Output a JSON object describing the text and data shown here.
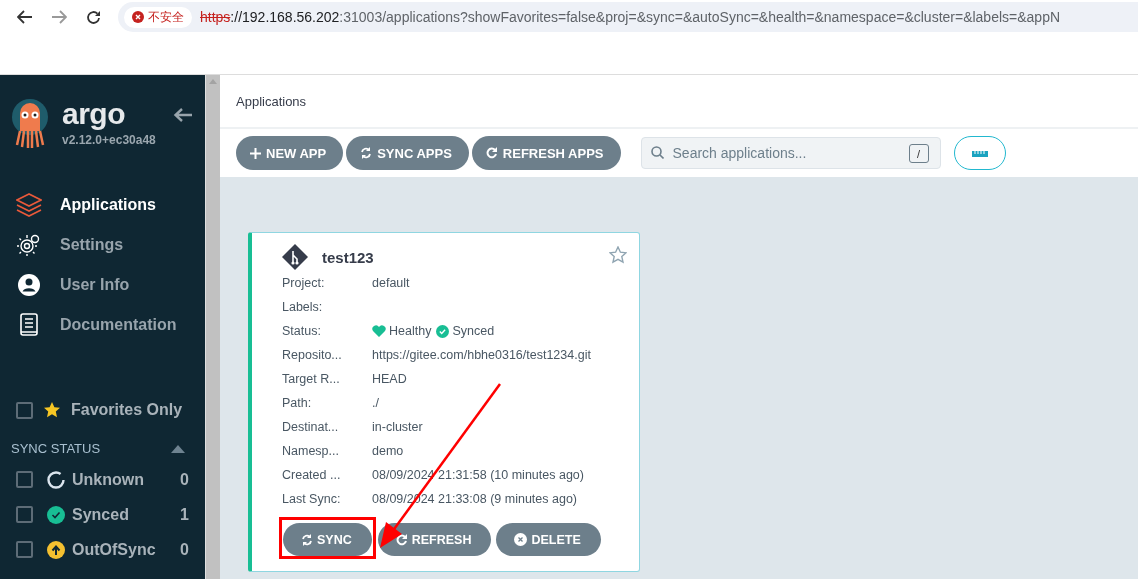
{
  "browser": {
    "security": "不安全",
    "url_scheme": "https",
    "url_host": "://192.168.56.202",
    "url_path": ":31003/applications?showFavorites=false&proj=&sync=&autoSync=&health=&namespace=&cluster=&labels=&appN"
  },
  "sidebar": {
    "logo": "argo",
    "version": "v2.12.0+ec30a48",
    "items": [
      {
        "label": "Applications",
        "kind": "apps",
        "selected": true
      },
      {
        "label": "Settings",
        "kind": "settings",
        "selected": false
      },
      {
        "label": "User Info",
        "kind": "user",
        "selected": false
      },
      {
        "label": "Documentation",
        "kind": "docs",
        "selected": false
      }
    ],
    "favorites": {
      "label": "Favorites Only",
      "checked": false
    },
    "sync_status": {
      "title": "SYNC STATUS",
      "expanded": true,
      "filters": [
        {
          "label": "Unknown",
          "kind": "unknown",
          "count": "0",
          "checked": false
        },
        {
          "label": "Synced",
          "kind": "synced",
          "count": "1",
          "checked": false
        },
        {
          "label": "OutOfSync",
          "kind": "outofsync",
          "count": "0",
          "checked": false
        }
      ]
    }
  },
  "breadcrumb": "Applications",
  "toolbar": {
    "buttons": [
      {
        "label": "NEW APP",
        "kind": "plus"
      },
      {
        "label": "SYNC APPS",
        "kind": "sync"
      },
      {
        "label": "REFRESH APPS",
        "kind": "refresh"
      }
    ],
    "search": {
      "placeholder": "Search applications...",
      "shortcut": "/"
    }
  },
  "card": {
    "name": "test123",
    "favorite": false,
    "fields": [
      {
        "label": "Project:",
        "value": "default",
        "kind": "text"
      },
      {
        "label": "Labels:",
        "kind": "text"
      },
      {
        "label": "Status:",
        "kind": "status",
        "health": "Healthy",
        "sync": "Synced"
      },
      {
        "label": "Reposito...",
        "value": "https://gitee.com/hbhe0316/test1234.git",
        "kind": "text"
      },
      {
        "label": "Target R...",
        "value": "HEAD",
        "kind": "text"
      },
      {
        "label": "Path:",
        "value": "./",
        "kind": "text"
      },
      {
        "label": "Destinat...",
        "value": "in-cluster",
        "kind": "text"
      },
      {
        "label": "Namesp...",
        "value": "demo",
        "kind": "text"
      },
      {
        "label": "Created ...",
        "value": "08/09/2024 21:31:58  (10 minutes ago)",
        "kind": "text"
      },
      {
        "label": "Last Sync:",
        "value": "08/09/2024 21:33:08  (9 minutes ago)",
        "kind": "text"
      }
    ],
    "actions": [
      {
        "label": "SYNC",
        "kind": "sync",
        "highlighted": true
      },
      {
        "label": "REFRESH",
        "kind": "refresh",
        "highlighted": false
      },
      {
        "label": "DELETE",
        "kind": "delete",
        "highlighted": false
      }
    ]
  }
}
